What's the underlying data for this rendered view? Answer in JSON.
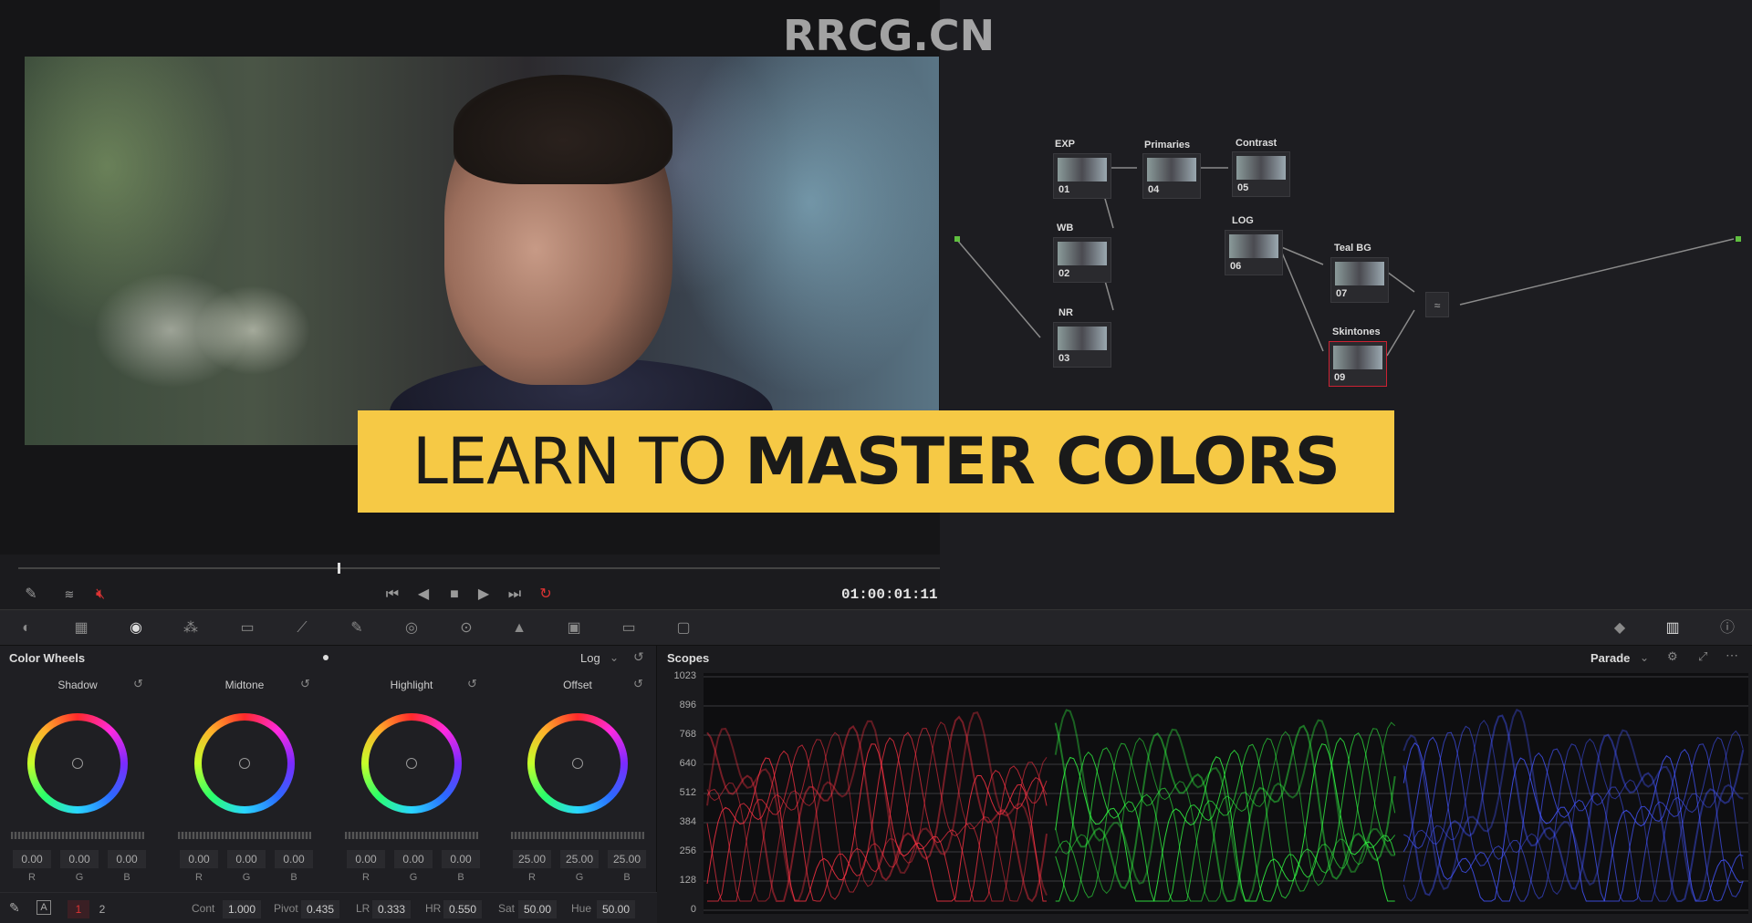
{
  "watermark": "RRCG.CN",
  "banner": {
    "light": "LEARN TO",
    "bold": "MASTER COLORS"
  },
  "viewer": {
    "timecode": "01:00:01:11"
  },
  "nodes": [
    {
      "label": "EXP",
      "num": "01"
    },
    {
      "label": "Primaries",
      "num": "04"
    },
    {
      "label": "Contrast",
      "num": "05"
    },
    {
      "label": "WB",
      "num": "02"
    },
    {
      "label": "LOG",
      "num": "06"
    },
    {
      "label": "Teal BG",
      "num": "07"
    },
    {
      "label": "NR",
      "num": "03"
    },
    {
      "label": "Skintones",
      "num": "09"
    }
  ],
  "wheels": {
    "title": "Color Wheels",
    "mode": "Log",
    "items": [
      {
        "name": "Shadow",
        "r": "0.00",
        "g": "0.00",
        "b": "0.00"
      },
      {
        "name": "Midtone",
        "r": "0.00",
        "g": "0.00",
        "b": "0.00"
      },
      {
        "name": "Highlight",
        "r": "0.00",
        "g": "0.00",
        "b": "0.00"
      },
      {
        "name": "Offset",
        "r": "25.00",
        "g": "25.00",
        "b": "25.00"
      }
    ],
    "ch": {
      "r": "R",
      "g": "G",
      "b": "B"
    }
  },
  "params": {
    "page1": "1",
    "page2": "2",
    "cont_label": "Cont",
    "cont": "1.000",
    "pivot_label": "Pivot",
    "pivot": "0.435",
    "lr_label": "LR",
    "lr": "0.333",
    "hr_label": "HR",
    "hr": "0.550",
    "sat_label": "Sat",
    "sat": "50.00",
    "hue_label": "Hue",
    "hue": "50.00"
  },
  "scopes": {
    "title": "Scopes",
    "mode": "Parade",
    "ticks": [
      "1023",
      "896",
      "768",
      "640",
      "512",
      "384",
      "256",
      "128",
      "0"
    ]
  },
  "colors": {
    "banner": "#f6c945",
    "red": "#ff3344",
    "green": "#33ff44",
    "blue": "#4455ff"
  },
  "icons": [
    "eyedropper-icon",
    "mute-icon",
    "skip-back-icon",
    "prev-frame-icon",
    "stop-icon",
    "play-icon",
    "skip-forward-icon",
    "loop-icon"
  ]
}
